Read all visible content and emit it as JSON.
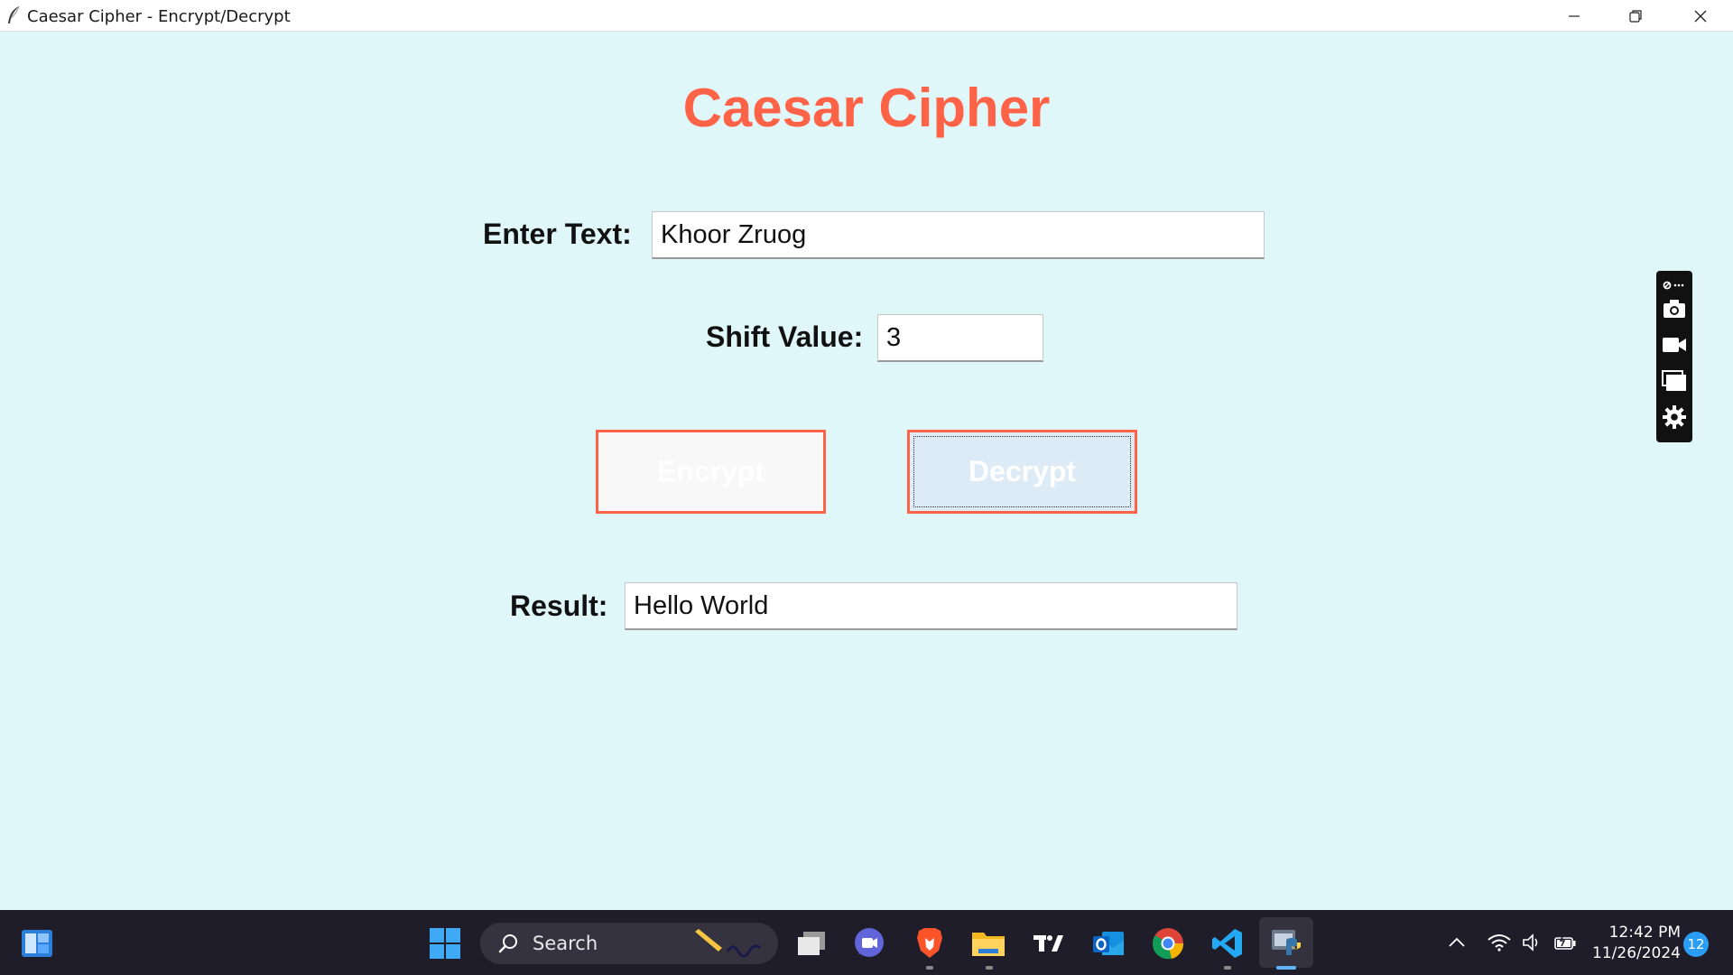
{
  "window": {
    "title": "Caesar Cipher - Encrypt/Decrypt"
  },
  "app": {
    "heading": "Caesar Cipher",
    "text_label": "Enter Text:",
    "text_value": "Khoor Zruog",
    "shift_label": "Shift Value:",
    "shift_value": "3",
    "encrypt_label": "Encrypt",
    "decrypt_label": "Decrypt",
    "result_label": "Result:",
    "result_value": "Hello World"
  },
  "capture_toolbar": {
    "icons": [
      "pin-more-icon",
      "camera-icon",
      "video-camera-icon",
      "window-capture-icon",
      "gear-icon"
    ]
  },
  "taskbar": {
    "search_label": "Search",
    "time": "12:42 PM",
    "date": "11/26/2024",
    "notification_count": "12",
    "apps": [
      "widgets",
      "start",
      "search",
      "task-view",
      "chat",
      "brave",
      "file-explorer",
      "tradingview",
      "outlook",
      "chrome",
      "vs-code",
      "python"
    ]
  },
  "colors": {
    "background": "#e0f7fa",
    "accent": "#ff6347",
    "taskbar": "#1f1d2a"
  }
}
